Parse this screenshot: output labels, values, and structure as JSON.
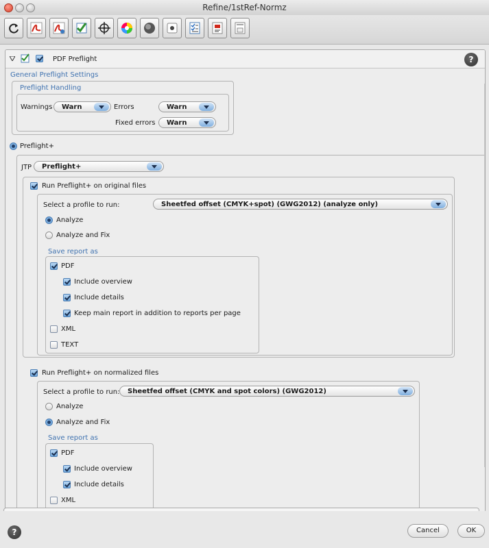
{
  "window": {
    "title": "Refine/1stRef-Normz"
  },
  "toolbar": {
    "buttons": [
      "refresh-icon",
      "pdf-icon",
      "pdf-edit-icon",
      "checkmark-icon",
      "target-icon",
      "color-wheel-icon",
      "sphere-icon",
      "record-icon",
      "checklist-icon",
      "report-icon",
      "calculator-icon"
    ]
  },
  "panel": {
    "title": "PDF Preflight"
  },
  "general": {
    "legend": "General Preflight Settings",
    "handling_legend": "Preflight Handling",
    "warnings_label": "Warnings",
    "warnings_value": "Warn",
    "errors_label": "Errors",
    "errors_value": "Warn",
    "fixed_label": "Fixed errors",
    "fixed_value": "Warn"
  },
  "preflight_plus": {
    "label": "Preflight+",
    "jtp_label": "JTP",
    "jtp_value": "Preflight+"
  },
  "original": {
    "label": "Run Preflight+ on original files",
    "profile_label": "Select a profile to run:",
    "profile_value": "Sheetfed offset (CMYK+spot) (GWG2012) (analyze only)",
    "analyze": "Analyze",
    "analyze_fix": "Analyze and Fix",
    "save_legend": "Save report as",
    "pdf": "PDF",
    "include_overview": "Include overview",
    "include_details": "Include details",
    "keep_main": "Keep main report in addition to reports per page",
    "xml": "XML",
    "text": "TEXT"
  },
  "normalized": {
    "label": "Run Preflight+ on normalized files",
    "profile_label": "Select a profile to run:",
    "profile_value": "Sheetfed offset (CMYK and spot colors) (GWG2012)",
    "analyze": "Analyze",
    "analyze_fix": "Analyze and Fix",
    "save_legend": "Save report as",
    "pdf": "PDF",
    "include_overview": "Include overview",
    "include_details": "Include details",
    "xml": "XML"
  },
  "footer": {
    "help": "?",
    "cancel": "Cancel",
    "ok": "OK"
  },
  "colors": {
    "accent": "#3f72b0",
    "checkbox": "#6ea6db"
  }
}
